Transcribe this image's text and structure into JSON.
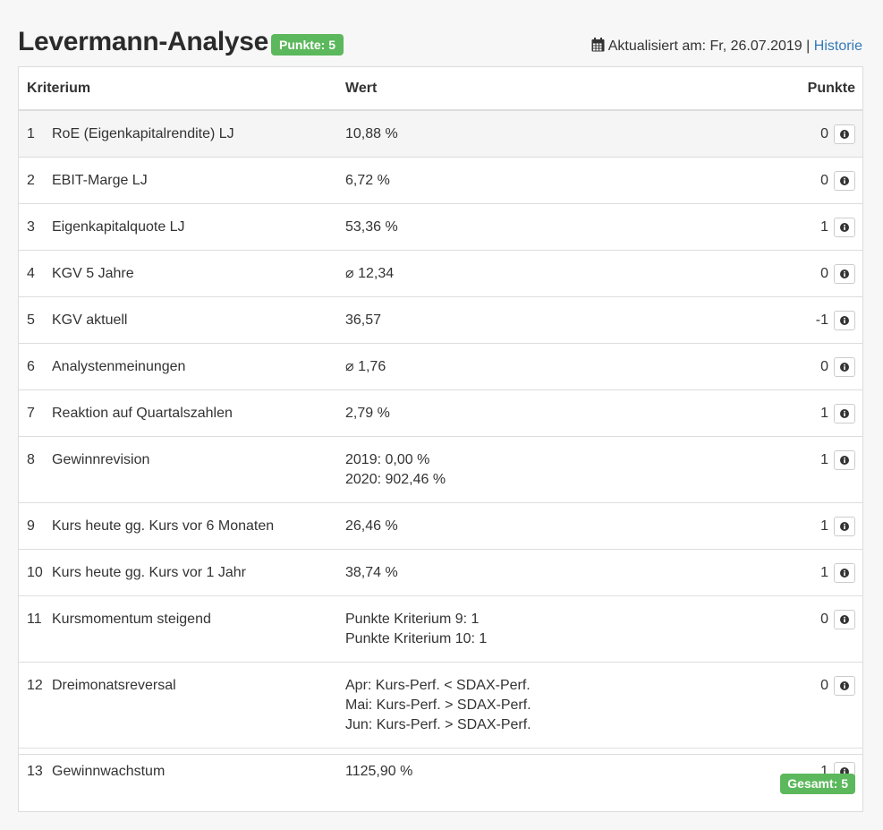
{
  "header": {
    "title": "Levermann-Analyse",
    "score_badge": "Punkte: 5",
    "updated_label": "Aktualisiert am: Fr, 26.07.2019 |",
    "history_link": "Historie"
  },
  "table": {
    "columns": {
      "criterion": "Kriterium",
      "value": "Wert",
      "points": "Punkte"
    },
    "rows": [
      {
        "num": "1",
        "name": "RoE (Eigenkapitalrendite) LJ",
        "values": [
          "10,88 %"
        ],
        "points": "0",
        "highlight": true
      },
      {
        "num": "2",
        "name": "EBIT-Marge LJ",
        "values": [
          "6,72 %"
        ],
        "points": "0"
      },
      {
        "num": "3",
        "name": "Eigenkapitalquote LJ",
        "values": [
          "53,36 %"
        ],
        "points": "1"
      },
      {
        "num": "4",
        "name": "KGV 5 Jahre",
        "values": [
          "⌀ 12,34"
        ],
        "points": "0"
      },
      {
        "num": "5",
        "name": "KGV aktuell",
        "values": [
          "36,57"
        ],
        "points": "-1"
      },
      {
        "num": "6",
        "name": "Analystenmeinungen",
        "values": [
          "⌀ 1,76"
        ],
        "points": "0"
      },
      {
        "num": "7",
        "name": "Reaktion auf Quartalszahlen",
        "values": [
          "2,79 %"
        ],
        "points": "1"
      },
      {
        "num": "8",
        "name": "Gewinnrevision",
        "values": [
          "2019: 0,00 %",
          "2020: 902,46 %"
        ],
        "points": "1"
      },
      {
        "num": "9",
        "name": "Kurs heute gg. Kurs vor 6 Monaten",
        "values": [
          "26,46 %"
        ],
        "points": "1"
      },
      {
        "num": "10",
        "name": "Kurs heute gg. Kurs vor 1 Jahr",
        "values": [
          "38,74 %"
        ],
        "points": "1"
      },
      {
        "num": "11",
        "name": "Kursmomentum steigend",
        "values": [
          "Punkte Kriterium 9: 1",
          "Punkte Kriterium 10: 1"
        ],
        "points": "0"
      },
      {
        "num": "12",
        "name": "Dreimonatsreversal",
        "values": [
          "Apr: Kurs-Perf. < SDAX-Perf.",
          "Mai: Kurs-Perf. > SDAX-Perf.",
          "Jun: Kurs-Perf. > SDAX-Perf."
        ],
        "points": "0"
      },
      {
        "num": "13",
        "name": "Gewinnwachstum",
        "values": [
          "1125,90 %"
        ],
        "points": "1"
      }
    ]
  },
  "footer": {
    "total_badge": "Gesamt: 5"
  },
  "icons": {
    "calendar": "calendar-icon",
    "info": "info-circle-icon"
  },
  "colors": {
    "badge_green": "#5cb85c",
    "link_blue": "#337ab7",
    "highlight_row": "#f5f5f5"
  }
}
